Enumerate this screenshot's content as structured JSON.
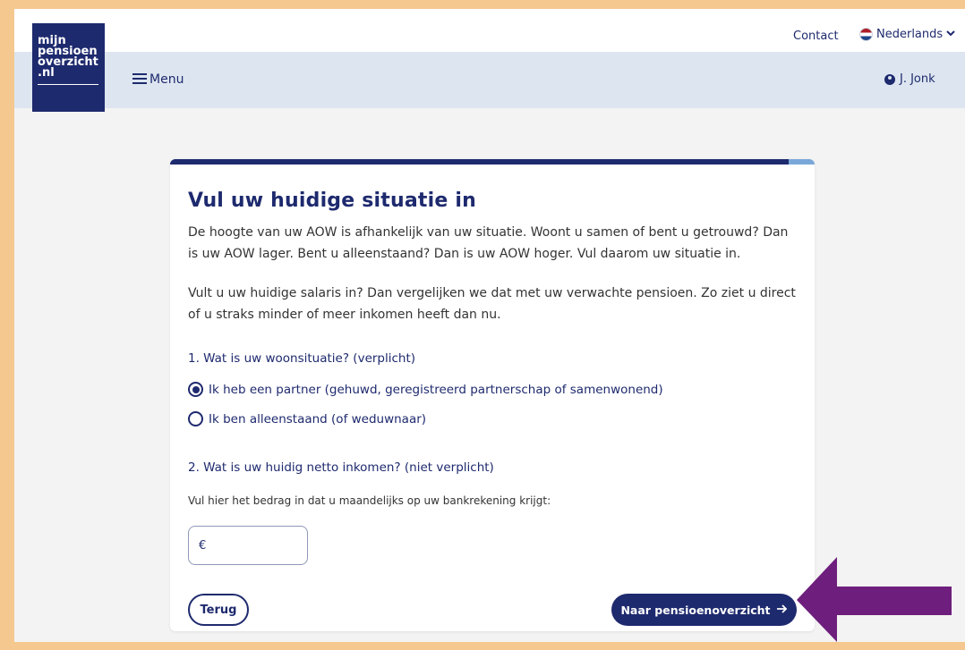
{
  "header": {
    "contact": "Contact",
    "language": "Nederlands",
    "menu": "Menu",
    "user": "J. Jonk",
    "logo_lines": [
      "mijn",
      "pensioen",
      "overzicht",
      ".nl"
    ]
  },
  "form": {
    "title": "Vul uw huidige situatie in",
    "intro_1": "De hoogte van uw AOW is afhankelijk van uw situatie. Woont u samen of bent u getrouwd? Dan is uw AOW lager. Bent u alleenstaand? Dan is uw AOW hoger. Vul daarom uw situatie in.",
    "intro_2": "Vult u uw huidige salaris in? Dan vergelijken we dat met uw verwachte pensioen. Zo ziet u direct of u straks minder of meer inkomen heeft dan nu.",
    "question_1": "1. Wat is uw woonsituatie? (verplicht)",
    "option_partner": "Ik heb een partner (gehuwd, geregistreerd partnerschap of samenwonend)",
    "option_single": "Ik ben alleenstaand (of weduwnaar)",
    "selected_option": "option_partner",
    "question_2": "2. Wat is uw huidig netto inkomen? (niet verplicht)",
    "hint": "Vul hier het bedrag in dat u maandelijks op uw bankrekening krijgt:",
    "currency_symbol": "€",
    "amount_value": "",
    "back_label": "Terug",
    "next_label": "Naar pensioenoverzicht"
  },
  "progress_fraction": 0.96,
  "colors": {
    "brand": "#1e2a6e",
    "navbar": "#dde6f0",
    "progress_track": "#79a8d8",
    "annotation_arrow": "#6e1e7c",
    "border_frame": "#f5c890"
  },
  "icons": {
    "menu": "hamburger-icon",
    "user": "user-circle-icon",
    "language": "netherlands-flag-icon",
    "dropdown": "chevron-down-icon",
    "next": "arrow-right-icon"
  }
}
